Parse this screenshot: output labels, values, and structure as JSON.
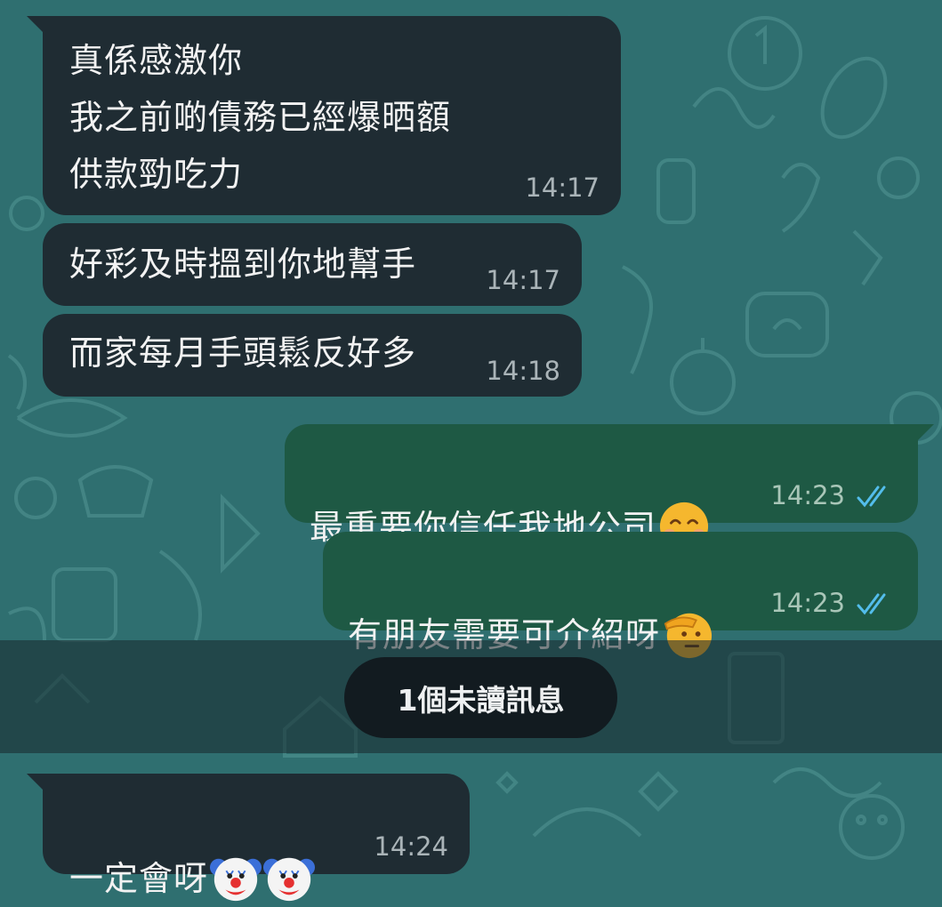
{
  "messages": [
    {
      "direction": "incoming",
      "text": "真係感激你\n我之前啲債務已經爆晒額\n供款勁吃力",
      "time": "14:17"
    },
    {
      "direction": "incoming",
      "text": "好彩及時搵到你地幫手",
      "time": "14:17"
    },
    {
      "direction": "incoming",
      "text": "而家每月手頭鬆反好多",
      "time": "14:18"
    },
    {
      "direction": "outgoing",
      "text": "最重要你信任我地公司",
      "emoji": "smiling-face-icon",
      "time": "14:23",
      "status": "read"
    },
    {
      "direction": "outgoing",
      "text": "有朋友需要可介紹呀",
      "emoji": "saluting-face-icon",
      "time": "14:23",
      "status": "read"
    },
    {
      "direction": "incoming",
      "text": "一定會呀",
      "emoji": "clown-face-icon",
      "emoji_count": 2,
      "time": "14:24"
    }
  ],
  "unread_divider": {
    "label": "1個未讀訊息"
  },
  "colors": {
    "background": "#2f6f70",
    "incoming_bubble": "#1f2c33",
    "outgoing_bubble": "#1e5944",
    "read_ticks": "#53bdeb"
  }
}
